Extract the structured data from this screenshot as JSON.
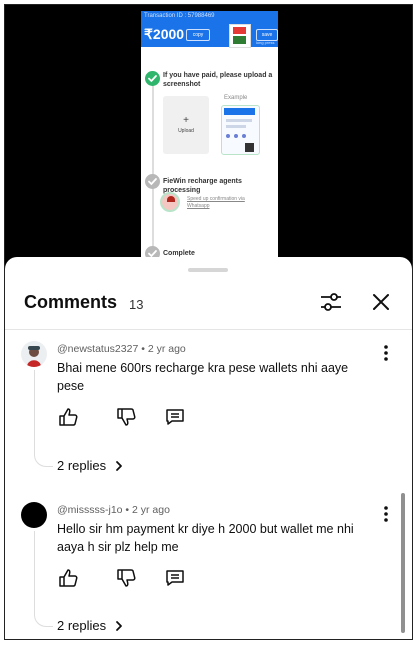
{
  "video": {
    "transaction_label": "Transaction ID : 57988469",
    "amount": "₹2000",
    "copy_label": "copy",
    "save_label": "save",
    "long_press_label": "long press",
    "steps": [
      {
        "text": "If you have paid, please upload a screenshot",
        "state": "done"
      },
      {
        "text": "FieWin recharge agents processing",
        "state": "pending"
      },
      {
        "text": "Complete",
        "state": "pending"
      }
    ],
    "upload_label": "Upload",
    "example_label": "Example",
    "agent_link": "Speed up confirmation via Whatsapp"
  },
  "comments": {
    "title": "Comments",
    "count": "13",
    "items": [
      {
        "author": "@newstatus2327",
        "time": "2 yr ago",
        "text": "Bhai mene 600rs recharge kra pese wallets nhi aaye pese",
        "replies_label": "2 replies"
      },
      {
        "author": "@misssss-j1o",
        "time": "2 yr ago",
        "text": "Hello sir hm payment kr diye h 2000 but wallet me nhi aaya h sir plz help me",
        "replies_label": "2 replies"
      }
    ]
  },
  "colors": {
    "accent_blue": "#1a73e8",
    "success_green": "#2fb66c",
    "pending_gray": "#b8b8b8"
  },
  "icons": [
    "filter-icon",
    "close-icon",
    "more-vert-icon",
    "thumb-up-icon",
    "thumb-down-icon",
    "reply-icon",
    "chevron-right-icon",
    "checkmark-icon"
  ]
}
